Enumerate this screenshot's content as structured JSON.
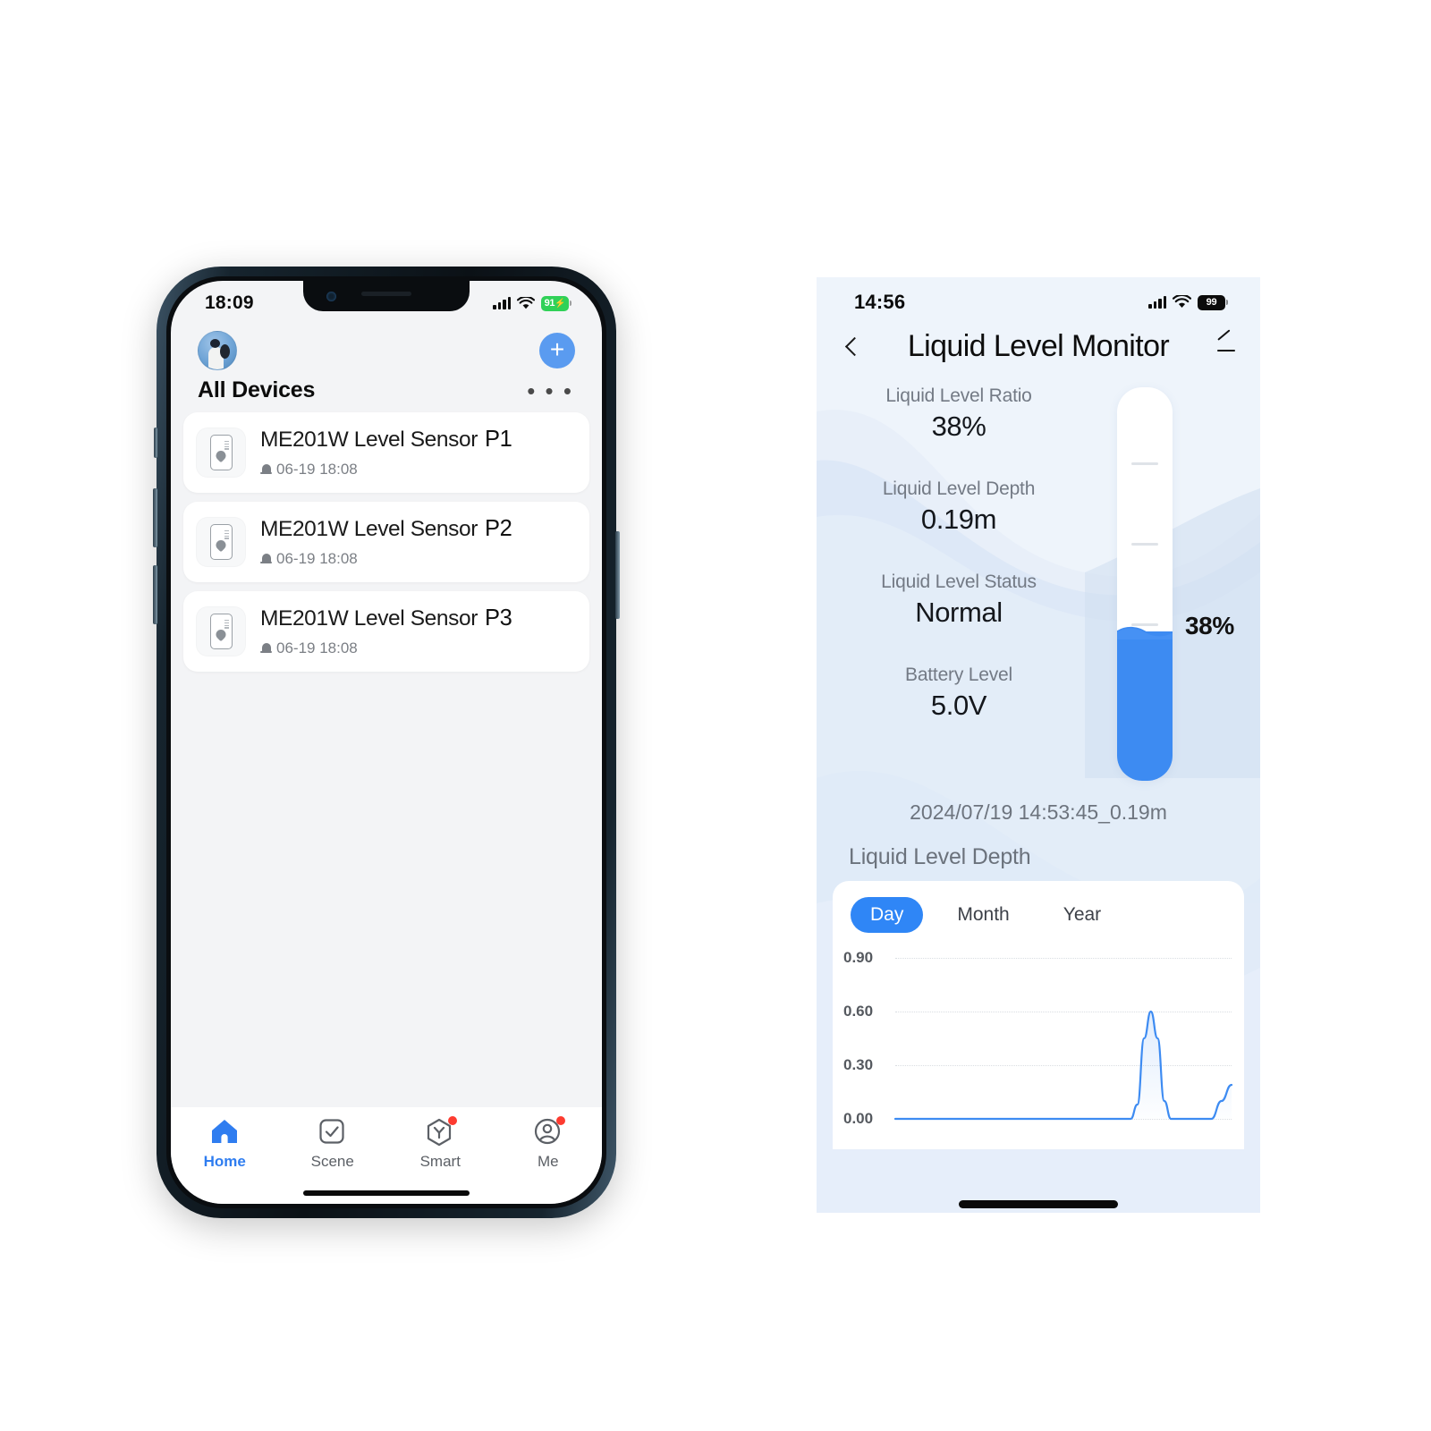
{
  "left_phone": {
    "status_bar": {
      "time": "18:09",
      "battery": "91",
      "battery_charging": true,
      "signal_icon": "cellular-bars-icon",
      "wifi_icon": "wifi-icon"
    },
    "header": {
      "avatar_name": "user-avatar",
      "add_label": "+",
      "section_title": "All Devices",
      "more_label": "• • •"
    },
    "devices": [
      {
        "name": "ME201W Level Sensor",
        "port": "P1",
        "timestamp": "06-19 18:08"
      },
      {
        "name": "ME201W Level Sensor",
        "port": "P2",
        "timestamp": "06-19 18:08"
      },
      {
        "name": "ME201W Level Sensor",
        "port": "P3",
        "timestamp": "06-19 18:08"
      }
    ],
    "tabs": [
      {
        "label": "Home",
        "icon": "home-icon",
        "active": true,
        "badge": false
      },
      {
        "label": "Scene",
        "icon": "check-square-icon",
        "active": false,
        "badge": false
      },
      {
        "label": "Smart",
        "icon": "hexagon-y-icon",
        "active": false,
        "badge": true
      },
      {
        "label": "Me",
        "icon": "person-circle-icon",
        "active": false,
        "badge": true
      }
    ],
    "accent_color": "#2f7df0"
  },
  "right_screenshot": {
    "status_bar": {
      "time": "14:56",
      "battery": "99",
      "battery_charging": false,
      "signal_icon": "cellular-bars-icon",
      "wifi_icon": "wifi-icon"
    },
    "header": {
      "back_icon": "chevron-left-icon",
      "title": "Liquid Level Monitor",
      "edit_icon": "pencil-edit-icon"
    },
    "metrics": [
      {
        "label": "Liquid Level Ratio",
        "value": "38%"
      },
      {
        "label": "Liquid Level Depth",
        "value": "0.19m"
      },
      {
        "label": "Liquid Level Status",
        "value": "Normal"
      },
      {
        "label": "Battery Level",
        "value": "5.0V"
      }
    ],
    "tube": {
      "percent_label": "38%",
      "fill_percent": 38,
      "fill_color": "#3d8bf2"
    },
    "latest_reading": "2024/07/19 14:53:45_0.19m",
    "chart_section_title": "Liquid Level Depth",
    "range_tabs": [
      {
        "label": "Day",
        "active": true
      },
      {
        "label": "Month",
        "active": false
      },
      {
        "label": "Year",
        "active": false
      }
    ],
    "background_color": "#e8eff9",
    "accent_color": "#2f86f6"
  },
  "chart_data": {
    "type": "line",
    "title": "Liquid Level Depth",
    "xlabel": "",
    "ylabel": "",
    "ylim": [
      0.0,
      0.9
    ],
    "yticks": [
      "0.00",
      "0.30",
      "0.60",
      "0.90"
    ],
    "grid": true,
    "legend": "none",
    "line_color": "#3d8bf2",
    "series": [
      {
        "name": "Liquid Level Depth",
        "x": [
          0,
          10,
          20,
          30,
          40,
          50,
          60,
          65,
          70,
          72,
          74,
          76,
          78,
          80,
          82,
          86,
          90,
          94,
          97,
          100
        ],
        "values": [
          0.0,
          0.0,
          0.0,
          0.0,
          0.0,
          0.0,
          0.0,
          0.0,
          0.0,
          0.08,
          0.45,
          0.6,
          0.45,
          0.1,
          0.0,
          0.0,
          0.0,
          0.0,
          0.1,
          0.19
        ]
      }
    ]
  }
}
